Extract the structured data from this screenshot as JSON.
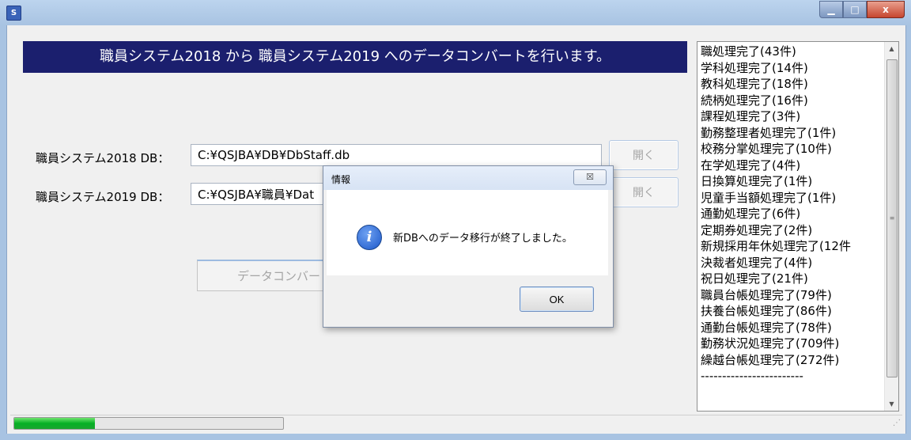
{
  "window": {
    "icon_label": "S",
    "controls": {
      "minimize": "▁",
      "maximize": "□",
      "close": "x"
    }
  },
  "banner": {
    "text": "職員システム2018 から 職員システム2019 へのデータコンバートを行います。"
  },
  "form": {
    "db2018": {
      "label": "職員システム2018 DB：",
      "value": "C:¥QSJBA¥DB¥DbStaff.db",
      "open_label": "開く"
    },
    "db2019": {
      "label": "職員システム2019 DB：",
      "value": "C:¥QSJBA¥職員¥Dat",
      "open_label": "開く"
    },
    "convert_label": "データコンバー"
  },
  "log": {
    "items": [
      "職処理完了(43件)",
      "学科処理完了(14件)",
      "教科処理完了(18件)",
      "続柄処理完了(16件)",
      "課程処理完了(3件)",
      "勤務整理者処理完了(1件)",
      "校務分掌処理完了(10件)",
      "在学処理完了(4件)",
      "日換算処理完了(1件)",
      "児童手当額処理完了(1件)",
      "通勤処理完了(6件)",
      "定期券処理完了(2件)",
      "新規採用年休処理完了(12件",
      "決裁者処理完了(4件)",
      "祝日処理完了(21件)",
      "職員台帳処理完了(79件)",
      "扶養台帳処理完了(86件)",
      "通勤台帳処理完了(78件)",
      "勤務状況処理完了(709件)",
      "繰越台帳処理完了(272件)",
      "------------------------"
    ]
  },
  "progress": {
    "value": 0.3
  },
  "dialog": {
    "title": "情報",
    "close": "☒",
    "message": "新DBへのデータ移行が終了しました。",
    "ok_label": "OK",
    "icon": "info-icon"
  }
}
